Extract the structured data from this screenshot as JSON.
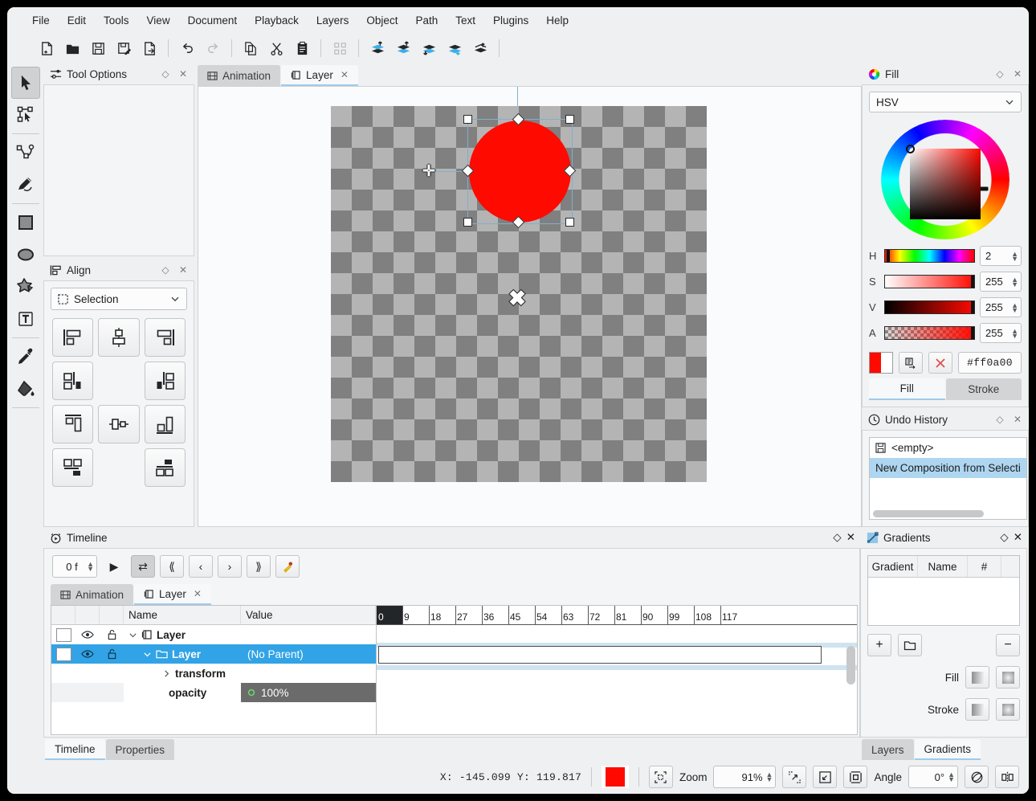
{
  "menubar": {
    "items": [
      {
        "label": "File"
      },
      {
        "label": "Edit"
      },
      {
        "label": "Tools"
      },
      {
        "label": "View"
      },
      {
        "label": "Document"
      },
      {
        "label": "Playback"
      },
      {
        "label": "Layers"
      },
      {
        "label": "Object"
      },
      {
        "label": "Path"
      },
      {
        "label": "Text"
      },
      {
        "label": "Plugins"
      },
      {
        "label": "Help"
      }
    ]
  },
  "toolbar": {
    "buttons": [
      {
        "name": "new-document-icon"
      },
      {
        "name": "open-folder-icon"
      },
      {
        "name": "save-icon"
      },
      {
        "name": "save-as-icon"
      },
      {
        "name": "export-icon"
      },
      {
        "name": "undo-icon"
      },
      {
        "name": "redo-icon"
      },
      {
        "name": "copy-icon"
      },
      {
        "name": "cut-icon"
      },
      {
        "name": "paste-icon"
      },
      {
        "name": "node-snap-icon"
      },
      {
        "name": "raise-to-top-icon"
      },
      {
        "name": "raise-icon"
      },
      {
        "name": "lower-icon"
      },
      {
        "name": "lower-to-bottom-icon"
      },
      {
        "name": "move-layer-icon"
      }
    ]
  },
  "tools": {
    "items": [
      {
        "name": "select-tool",
        "active": true
      },
      {
        "name": "node-edit-tool",
        "active": false
      },
      {
        "name": "pen-tool",
        "active": false
      },
      {
        "name": "pencil-tool",
        "active": false
      },
      {
        "name": "rectangle-tool",
        "active": false
      },
      {
        "name": "ellipse-tool",
        "active": false
      },
      {
        "name": "star-tool",
        "active": false
      },
      {
        "name": "text-tool",
        "active": false
      },
      {
        "name": "eyedropper-tool",
        "active": false
      },
      {
        "name": "fill-bucket-tool",
        "active": false
      }
    ]
  },
  "tool_options": {
    "title": "Tool Options"
  },
  "align": {
    "title": "Align",
    "target": "Selection",
    "buttons": [
      "align-left-edges",
      "align-horizontal-center",
      "align-right-edges",
      "align-left-to-anchor",
      "",
      "align-right-to-anchor",
      "align-top-edges",
      "align-vertical-center",
      "align-bottom-edges",
      "align-top-to-anchor",
      "",
      "align-bottom-to-anchor"
    ]
  },
  "canvas": {
    "tabs": [
      {
        "label": "Animation",
        "active": false,
        "closable": false
      },
      {
        "label": "Layer",
        "active": true,
        "closable": true
      }
    ],
    "shape_color": "#ff0a00"
  },
  "fill": {
    "title": "Fill",
    "color_model": "HSV",
    "channels": [
      {
        "label": "H",
        "value": "2"
      },
      {
        "label": "S",
        "value": "255"
      },
      {
        "label": "V",
        "value": "255"
      },
      {
        "label": "A",
        "value": "255"
      }
    ],
    "hex": "#ff0a00",
    "tabs": [
      {
        "label": "Fill",
        "active": true
      },
      {
        "label": "Stroke",
        "active": false
      }
    ]
  },
  "undo_history": {
    "title": "Undo History",
    "items": [
      {
        "label": "<empty>",
        "selected": false,
        "has_icon": true
      },
      {
        "label": "New Composition from Selecti",
        "selected": true,
        "has_icon": false
      }
    ]
  },
  "timeline": {
    "title": "Timeline",
    "frame": "0 f",
    "controls": [
      {
        "name": "play-button",
        "glyph": "▶"
      },
      {
        "name": "loop-button",
        "glyph": "⇄"
      },
      {
        "name": "first-frame-button",
        "glyph": "⟪"
      },
      {
        "name": "prev-frame-button",
        "glyph": "‹"
      },
      {
        "name": "next-frame-button",
        "glyph": "›"
      },
      {
        "name": "last-frame-button",
        "glyph": "⟫"
      },
      {
        "name": "add-keyframe-button",
        "glyph": "⚷"
      }
    ],
    "tabs": [
      {
        "label": "Animation",
        "active": false,
        "closable": false
      },
      {
        "label": "Layer",
        "active": true,
        "closable": true
      }
    ],
    "columns": [
      "Name",
      "Value"
    ],
    "rows": [
      {
        "name": "Layer",
        "value": "",
        "indent": 0,
        "selected": false,
        "bold": true,
        "icon": "layer-icon",
        "has_checkbox": true,
        "has_eye": true,
        "has_lock": true
      },
      {
        "name": "Layer",
        "value": "(No Parent)",
        "indent": 1,
        "selected": true,
        "bold": true,
        "icon": "folder-icon",
        "has_checkbox": true,
        "has_eye": true,
        "has_lock": true
      },
      {
        "name": "transform",
        "value": "",
        "indent": 2,
        "selected": false,
        "bold": true,
        "icon": "",
        "has_checkbox": false,
        "has_eye": false,
        "has_lock": false
      },
      {
        "name": "opacity",
        "value": "100%",
        "indent": 2,
        "selected": false,
        "bold": true,
        "icon": "",
        "has_checkbox": false,
        "has_eye": false,
        "has_lock": false
      }
    ],
    "ruler_labels": [
      "0",
      "9",
      "18",
      "27",
      "36",
      "45",
      "54",
      "63",
      "72",
      "81",
      "90",
      "99",
      "108",
      "117"
    ],
    "bottom_tabs": [
      {
        "label": "Timeline",
        "active": true
      },
      {
        "label": "Properties",
        "active": false
      }
    ]
  },
  "gradients": {
    "title": "Gradients",
    "columns": [
      "Gradient",
      "Name",
      "#"
    ],
    "buttons": [
      {
        "name": "add-gradient-button",
        "glyph": "+"
      },
      {
        "name": "load-gradient-button",
        "glyph": "folder"
      },
      {
        "name": "remove-gradient-button",
        "glyph": "−"
      }
    ],
    "fill_label": "Fill",
    "stroke_label": "Stroke",
    "tabs": [
      {
        "label": "Layers",
        "active": false
      },
      {
        "label": "Gradients",
        "active": true
      }
    ]
  },
  "statusbar": {
    "coords": "X:  -145.099 Y:   119.817",
    "color": "#ff0a00",
    "zoom_label": "Zoom",
    "zoom_value": "91%",
    "angle_label": "Angle",
    "angle_value": "0°"
  }
}
